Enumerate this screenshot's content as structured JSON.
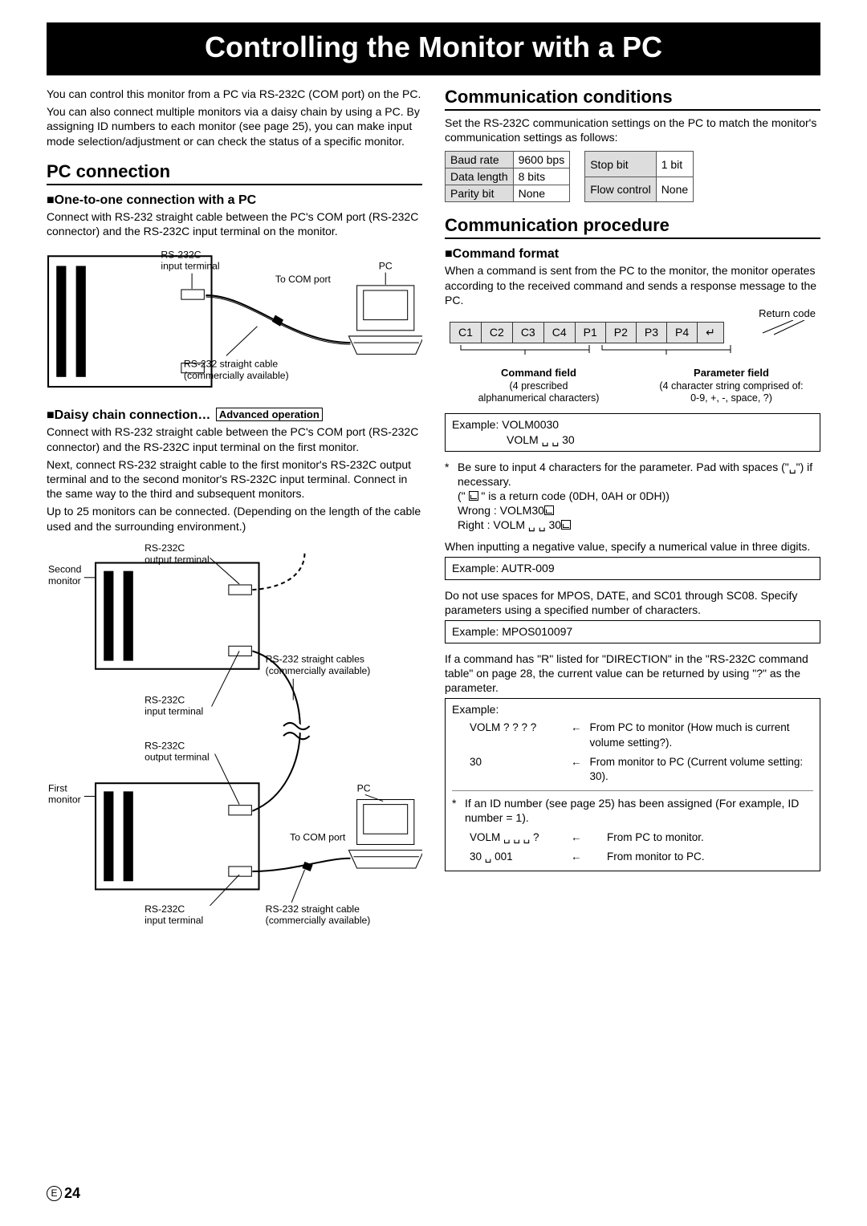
{
  "title": "Controlling the Monitor with a PC",
  "intro_p1": "You can control this monitor from a PC via RS-232C (COM port) on the PC.",
  "intro_p2": "You can also connect multiple monitors via a daisy chain by using a PC. By assigning ID numbers to each monitor (see page 25), you can make input mode selection/adjustment or can check the status of a specific monitor.",
  "pc_conn": {
    "heading": "PC connection",
    "one_to_one_heading": "One-to-one connection with a PC",
    "one_to_one_body": "Connect with RS-232 straight cable between the PC's COM port (RS-232C connector) and the RS-232C input terminal on the monitor.",
    "fig1": {
      "rs232c_in": "RS-232C\ninput terminal",
      "to_com": "To COM port",
      "pc": "PC",
      "cable": "RS-232 straight cable\n(commercially available)"
    },
    "daisy_heading": "Daisy chain connection…",
    "adv_badge": "Advanced operation",
    "daisy_p1": "Connect with RS-232 straight cable between the PC's COM port (RS-232C connector) and the RS-232C input terminal on the first monitor.",
    "daisy_p2": "Next, connect RS-232 straight cable to the first monitor's RS-232C output terminal and to the second monitor's RS-232C input terminal. Connect in the same way to the third and subsequent monitors.",
    "daisy_p3": "Up to 25 monitors can be connected. (Depending on the length of the cable used and the surrounding environment.)",
    "fig2": {
      "second_mon": "Second\nmonitor",
      "first_mon": "First\nmonitor",
      "rs232c_out_top": "RS-232C\noutput terminal",
      "rs232c_in_mid": "RS-232C\ninput terminal",
      "rs232c_out_mid": "RS-232C\noutput terminal",
      "rs232c_in_bot": "RS-232C\ninput terminal",
      "cables_plural": "RS-232 straight cables\n(commercially available)",
      "cable_single": "RS-232 straight cable\n(commercially available)",
      "to_com": "To COM port",
      "pc": "PC"
    }
  },
  "comm_cond": {
    "heading": "Communication conditions",
    "body": "Set the RS-232C communication settings on the PC to match the monitor's communication settings as follows:",
    "table1": [
      [
        "Baud rate",
        "9600 bps"
      ],
      [
        "Data length",
        "8 bits"
      ],
      [
        "Parity bit",
        "None"
      ]
    ],
    "table2": [
      [
        "Stop bit",
        "1 bit"
      ],
      [
        "Flow control",
        "None"
      ]
    ]
  },
  "comm_proc": {
    "heading": "Communication procedure",
    "cmd_fmt_heading": "Command format",
    "cmd_fmt_body": "When a command is sent from the PC to the monitor, the monitor operates according to the received command and sends a response message to the PC.",
    "return_label": "Return code",
    "cells": [
      "C1",
      "C2",
      "C3",
      "C4",
      "P1",
      "P2",
      "P3",
      "P4",
      "↵"
    ],
    "legend_cmd_title": "Command field",
    "legend_cmd_body": "(4 prescribed\nalphanumerical characters)",
    "legend_par_title": "Parameter field",
    "legend_par_body": "(4 character string comprised of:\n0-9, +, -, space, ?)",
    "ex1_line1": "Example:  VOLM0030",
    "ex1_line2": "VOLM ␣ ␣ 30",
    "note1_a": "Be sure to input 4 characters for the parameter. Pad with spaces (\"␣\") if necessary.",
    "note1_b": "(\" ",
    "note1_c": " \" is a return code (0DH, 0AH or 0DH))",
    "wrong": "Wrong  : VOLM30",
    "right": "Right    : VOLM ␣ ␣ 30",
    "neg_body": "When inputting a negative value, specify a numerical value in three digits.",
    "ex2": "Example: AUTR-009",
    "mpos_body": "Do not use spaces for MPOS, DATE, and SC01 through SC08. Specify parameters using a specified number of characters.",
    "ex3": "Example: MPOS010097",
    "r_body": "If a command has \"R\" listed for \"DIRECTION\" in the \"RS-232C command table\" on page 28, the current value can be returned by using \"?\" as the parameter.",
    "ex4": {
      "header": "Example:",
      "r1_cmd": "VOLM ? ? ? ?",
      "r1_desc": "From PC to monitor (How much is current volume setting?).",
      "r2_cmd": "30",
      "r2_desc": "From monitor to PC (Current volume setting: 30).",
      "sub_note": "If an ID number (see page 25) has been assigned (For example, ID number = 1).",
      "r3_cmd": "VOLM ␣ ␣ ␣ ?",
      "r3_desc": "From PC to monitor.",
      "r4_cmd": "30 ␣ 001",
      "r4_desc": "From monitor to PC."
    }
  },
  "page_e": "E",
  "page_num": "24"
}
